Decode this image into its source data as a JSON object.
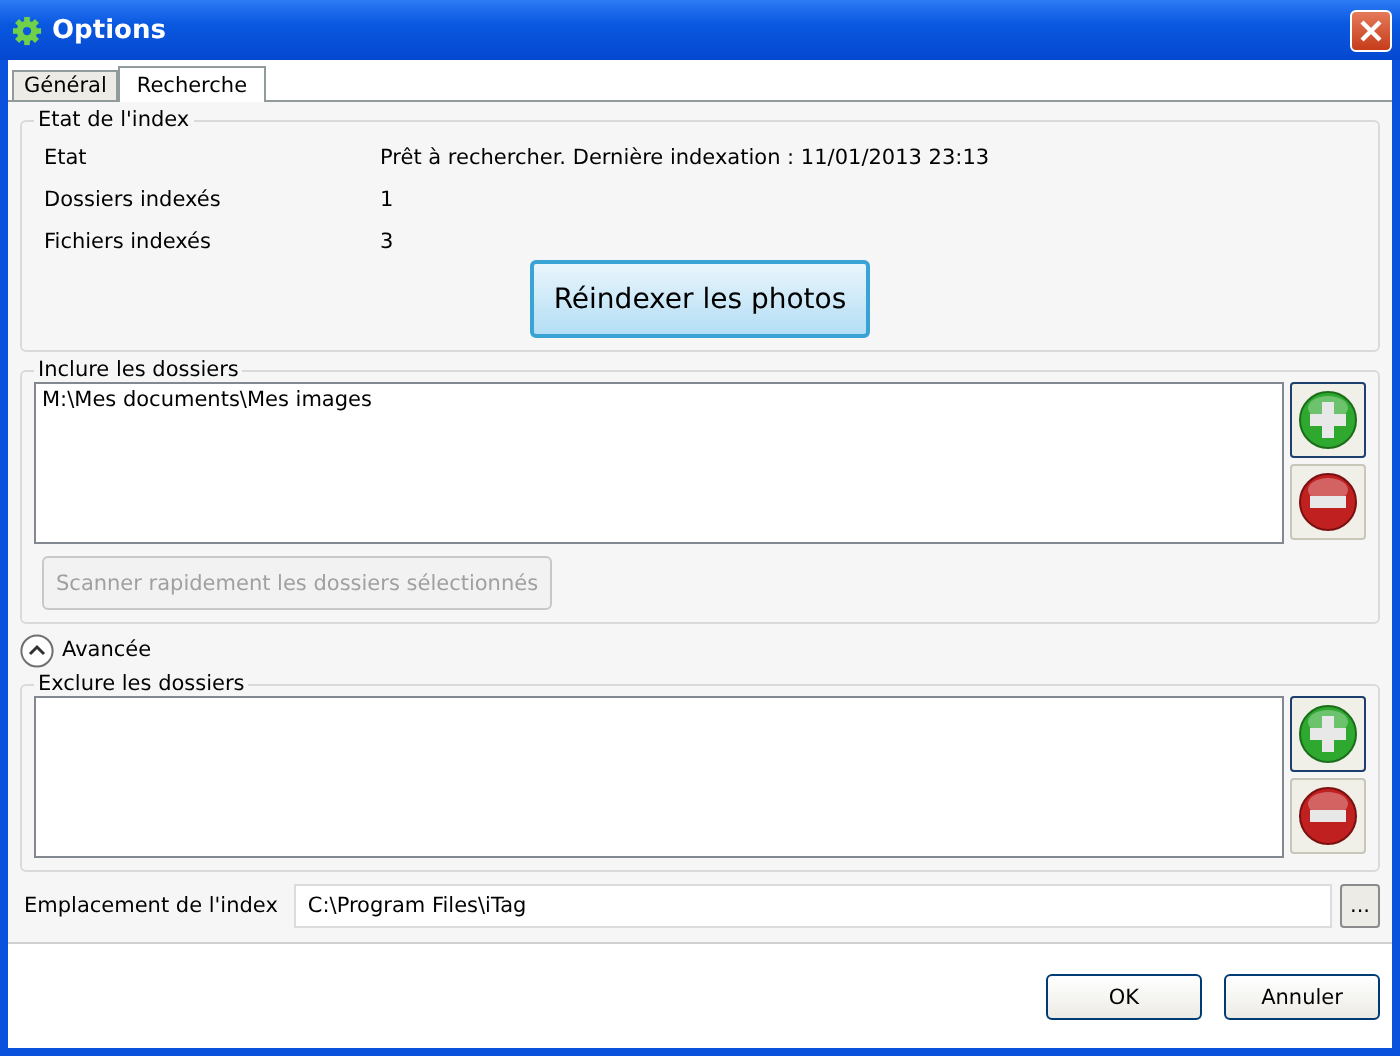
{
  "window": {
    "title": "Options"
  },
  "tabs": [
    {
      "label": "Général",
      "selected": false
    },
    {
      "label": "Recherche",
      "selected": true
    }
  ],
  "index_status": {
    "legend": "Etat de l'index",
    "rows": [
      {
        "label": "Etat",
        "value": "Prêt à rechercher. Dernière indexation : 11/01/2013 23:13"
      },
      {
        "label": "Dossiers indexés",
        "value": "1"
      },
      {
        "label": "Fichiers indexés",
        "value": "3"
      }
    ],
    "reindex_button": "Réindexer les photos"
  },
  "include": {
    "legend": "Inclure les dossiers",
    "folders": [
      "M:\\Mes documents\\Mes images"
    ],
    "scan_button": {
      "label": "Scanner rapidement les dossiers sélectionnés",
      "disabled": true
    }
  },
  "advanced": {
    "label": "Avancée",
    "expanded": true
  },
  "exclude": {
    "legend": "Exclure les dossiers"
  },
  "index_location": {
    "label": "Emplacement de l'index",
    "value": "C:\\Program Files\\iTag",
    "browse_button": "..."
  },
  "buttons": [
    "OK",
    "Annuler"
  ]
}
